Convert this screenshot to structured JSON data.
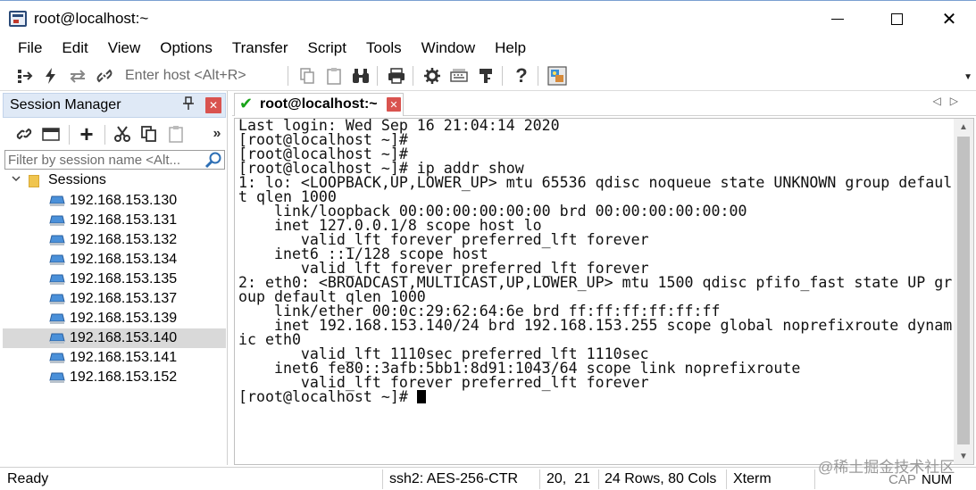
{
  "window": {
    "title": "root@localhost:~",
    "min_glyph": "",
    "max_glyph": "",
    "close_glyph": "✕"
  },
  "menu": [
    "File",
    "Edit",
    "View",
    "Options",
    "Transfer",
    "Script",
    "Tools",
    "Window",
    "Help"
  ],
  "toolbar": {
    "host_placeholder": "Enter host <Alt+R>"
  },
  "session_manager": {
    "title": "Session Manager",
    "filter_placeholder": "Filter by session name <Alt...",
    "root_label": "Sessions",
    "sessions": [
      "192.168.153.130",
      "192.168.153.131",
      "192.168.153.132",
      "192.168.153.134",
      "192.168.153.135",
      "192.168.153.137",
      "192.168.153.139",
      "192.168.153.140",
      "192.168.153.141",
      "192.168.153.152"
    ],
    "selected_session": "192.168.153.140"
  },
  "tab": {
    "title": "root@localhost:~"
  },
  "terminal": {
    "lines": [
      "Last login: Wed Sep 16 21:04:14 2020",
      "[root@localhost ~]#",
      "[root@localhost ~]#",
      "[root@localhost ~]# ip addr show",
      "1: lo: <LOOPBACK,UP,LOWER_UP> mtu 65536 qdisc noqueue state UNKNOWN group defaul",
      "t qlen 1000",
      "    link/loopback 00:00:00:00:00:00 brd 00:00:00:00:00:00",
      "    inet 127.0.0.1/8 scope host lo",
      "       valid_lft forever preferred_lft forever",
      "    inet6 ::1/128 scope host",
      "       valid_lft forever preferred_lft forever",
      "2: eth0: <BROADCAST,MULTICAST,UP,LOWER_UP> mtu 1500 qdisc pfifo_fast state UP gr",
      "oup default qlen 1000",
      "    link/ether 00:0c:29:62:64:6e brd ff:ff:ff:ff:ff:ff",
      "    inet 192.168.153.140/24 brd 192.168.153.255 scope global noprefixroute dynam",
      "ic eth0",
      "       valid_lft 1110sec preferred_lft 1110sec",
      "    inet6 fe80::3afb:5bb1:8d91:1043/64 scope link noprefixroute",
      "       valid_lft forever preferred_lft forever"
    ],
    "prompt": "[root@localhost ~]# "
  },
  "status": {
    "ready": "Ready",
    "cipher": "ssh2: AES-256-CTR",
    "position": "20,  21",
    "size": "24 Rows, 80 Cols",
    "term_type": "Xterm",
    "cap": "CAP",
    "num": "NUM"
  },
  "watermark": "@稀土掘金技术社区",
  "colors": {
    "accent": "#dfe9f6",
    "close_red": "#d9534f",
    "connected_green": "#19a319",
    "selected_row": "#d9d9d9"
  }
}
